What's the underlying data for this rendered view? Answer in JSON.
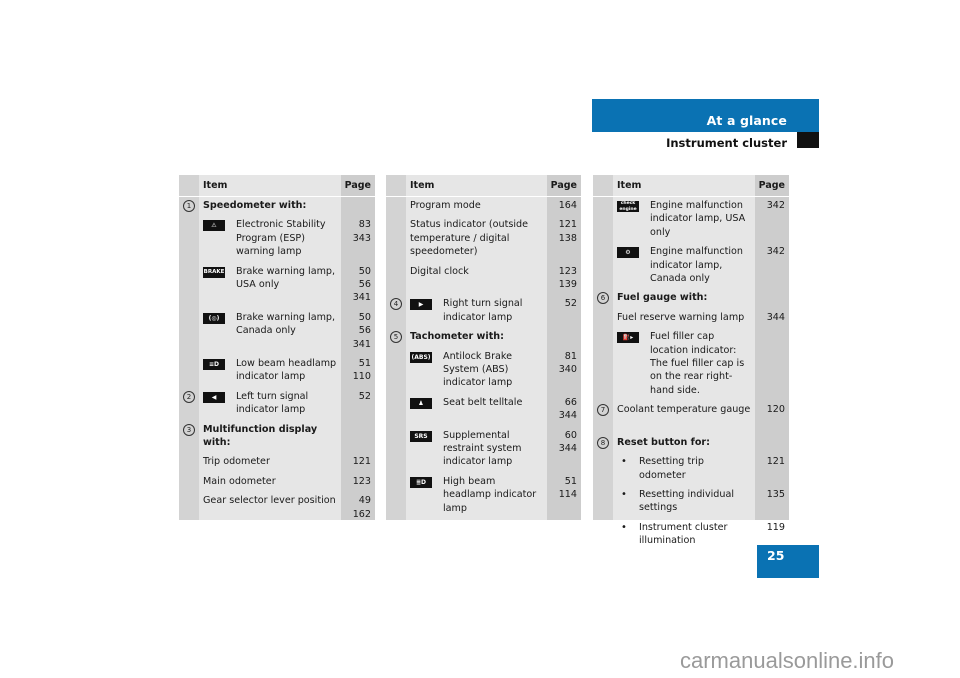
{
  "header": {
    "section": "At a glance",
    "subsection": "Instrument cluster"
  },
  "page_number": "25",
  "watermark": "carmanualsonline.info",
  "columns": {
    "item": "Item",
    "page": "Page"
  },
  "tables": [
    {
      "rows": [
        {
          "marker": "1",
          "text": "Speedometer with:",
          "bold": true,
          "pages": ""
        },
        {
          "icon": "esp-warning-icon",
          "icon_glyph": "⚠",
          "text": "Electronic Stability Program (ESP) warning lamp",
          "pages": "83\n343"
        },
        {
          "icon": "brake-usa-icon",
          "icon_glyph": "BRAKE",
          "text": "Brake warning lamp, USA only",
          "pages": "50\n56\n341"
        },
        {
          "icon": "brake-canada-icon",
          "icon_glyph": "(◎)",
          "text": "Brake warning lamp, Canada only",
          "pages": "50\n56\n341"
        },
        {
          "icon": "low-beam-icon",
          "icon_glyph": "≡D",
          "text": "Low beam headlamp indicator lamp",
          "pages": "51\n110"
        },
        {
          "marker": "2",
          "icon": "left-turn-signal-icon",
          "icon_glyph": "◀",
          "text": "Left turn signal indicator lamp",
          "pages": "52"
        },
        {
          "marker": "3",
          "text": "Multifunction display with:",
          "bold": true,
          "pages": ""
        },
        {
          "text": "Trip odometer",
          "pages": "121"
        },
        {
          "text": "Main odometer",
          "pages": "123"
        },
        {
          "text": "Gear selector lever position",
          "pages": "49\n162"
        }
      ]
    },
    {
      "rows": [
        {
          "text": "Program mode",
          "pages": "164"
        },
        {
          "text": "Status indicator (outside temperature / digital speedometer)",
          "pages": "121\n138"
        },
        {
          "text": "Digital clock",
          "pages": "123\n139"
        },
        {
          "marker": "4",
          "icon": "right-turn-signal-icon",
          "icon_glyph": "▶",
          "text": "Right turn signal indicator lamp",
          "pages": "52"
        },
        {
          "marker": "5",
          "text": "Tachometer with:",
          "bold": true,
          "pages": ""
        },
        {
          "icon": "abs-icon",
          "icon_glyph": "(ABS)",
          "text": "Antilock Brake System (ABS) indicator lamp",
          "pages": "81\n340"
        },
        {
          "icon": "seat-belt-icon",
          "icon_glyph": "♟",
          "text": "Seat belt telltale",
          "pages": "66\n344"
        },
        {
          "icon": "srs-icon",
          "icon_glyph": "SRS",
          "text": "Supplemental restraint system indicator lamp",
          "pages": "60\n344"
        },
        {
          "icon": "high-beam-icon",
          "icon_glyph": "≣D",
          "text": "High beam headlamp indicator lamp",
          "pages": "51\n114"
        }
      ]
    },
    {
      "rows": [
        {
          "icon": "check-engine-icon",
          "icon_glyph": "check engine",
          "text": "Engine malfunction indicator lamp, USA only",
          "pages": "342"
        },
        {
          "icon": "engine-canada-icon",
          "icon_glyph": "⚙",
          "text": "Engine malfunction indicator lamp, Canada only",
          "pages": "342"
        },
        {
          "marker": "6",
          "text": "Fuel gauge with:",
          "bold": true,
          "pages": ""
        },
        {
          "text": "Fuel reserve warning lamp",
          "pages": "344"
        },
        {
          "icon": "fuel-filler-icon",
          "icon_glyph": "⛽▸",
          "text": "Fuel filler cap location indicator: The fuel filler cap is on the rear right-hand side.",
          "pages": ""
        },
        {
          "marker": "7",
          "text": "Coolant temperature gauge",
          "pages": "120",
          "extra_gap": true
        },
        {
          "marker": "8",
          "text": "Reset button for:",
          "bold": true,
          "pages": ""
        },
        {
          "bullet": true,
          "text": "Resetting trip odometer",
          "pages": "121"
        },
        {
          "bullet": true,
          "text": "Resetting individual settings",
          "pages": "135"
        },
        {
          "bullet": true,
          "text": "Instrument cluster illumination",
          "pages": "119"
        }
      ]
    }
  ]
}
